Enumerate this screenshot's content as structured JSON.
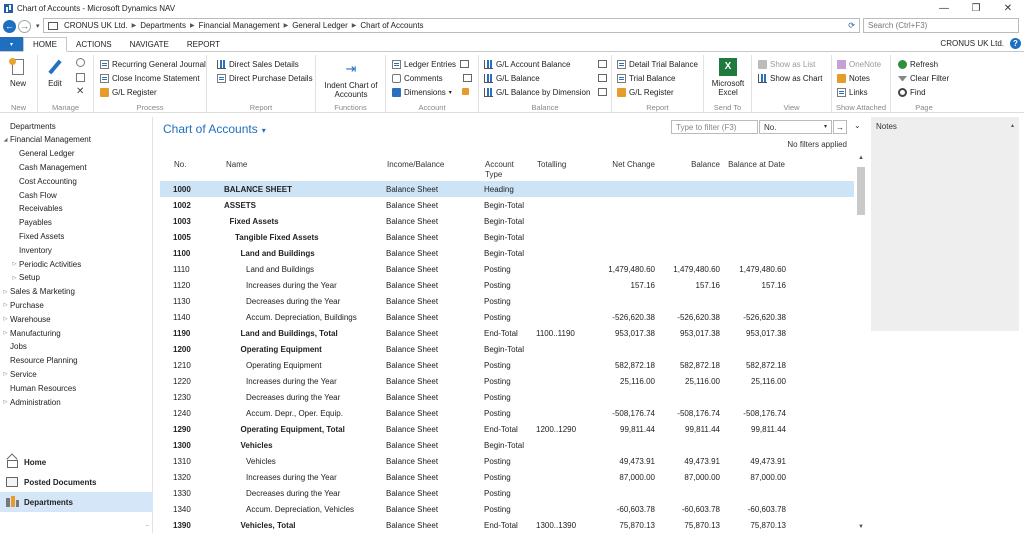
{
  "window": {
    "title": "Chart of Accounts - Microsoft Dynamics NAV",
    "controls": [
      "—",
      "❐",
      "✕"
    ]
  },
  "address": {
    "crumbs": [
      "CRONUS UK Ltd.",
      "Departments",
      "Financial Management",
      "General Ledger",
      "Chart of Accounts"
    ],
    "search_placeholder": "Search (Ctrl+F3)"
  },
  "ribbon_tabs": {
    "file": "▾",
    "items": [
      "HOME",
      "ACTIONS",
      "NAVIGATE",
      "REPORT"
    ],
    "company": "CRONUS UK Ltd.",
    "help": "?"
  },
  "ribbon": {
    "new": {
      "label": "New",
      "group": "New"
    },
    "manage": {
      "edit": "Edit",
      "group": "Manage"
    },
    "process": {
      "items": [
        "Recurring General Journal",
        "Close Income Statement",
        "G/L Register"
      ],
      "group": "Process"
    },
    "report": {
      "items": [
        "Direct Sales Details",
        "Direct Purchase Details"
      ],
      "group": "Report"
    },
    "functions": {
      "label": "Indent Chart of Accounts",
      "group": "Functions"
    },
    "account": {
      "items": [
        "Ledger Entries",
        "Comments",
        "Dimensions"
      ],
      "group": "Account"
    },
    "balance": {
      "items": [
        "G/L Account Balance",
        "G/L Balance",
        "G/L Balance by Dimension"
      ],
      "group": "Balance"
    },
    "report2": {
      "items": [
        "Detail Trial Balance",
        "Trial Balance",
        "G/L Register"
      ],
      "group": "Report"
    },
    "sendto": {
      "label": "Microsoft Excel",
      "group": "Send To"
    },
    "view": {
      "items": [
        "Show as List",
        "Show as Chart"
      ],
      "group": "View"
    },
    "attached": {
      "items": [
        "OneNote",
        "Notes",
        "Links"
      ],
      "group": "Show Attached"
    },
    "page": {
      "items": [
        "Refresh",
        "Clear Filter",
        "Find"
      ],
      "group": "Page"
    }
  },
  "sidebar": {
    "items": [
      {
        "label": "Departments",
        "level": 0,
        "arrow": ""
      },
      {
        "label": "Financial Management",
        "level": 0,
        "arrow": "◢"
      },
      {
        "label": "General Ledger",
        "level": 1,
        "arrow": ""
      },
      {
        "label": "Cash Management",
        "level": 1,
        "arrow": ""
      },
      {
        "label": "Cost Accounting",
        "level": 1,
        "arrow": ""
      },
      {
        "label": "Cash Flow",
        "level": 1,
        "arrow": ""
      },
      {
        "label": "Receivables",
        "level": 1,
        "arrow": ""
      },
      {
        "label": "Payables",
        "level": 1,
        "arrow": ""
      },
      {
        "label": "Fixed Assets",
        "level": 1,
        "arrow": ""
      },
      {
        "label": "Inventory",
        "level": 1,
        "arrow": ""
      },
      {
        "label": "Periodic Activities",
        "level": 1,
        "arrow": "▷"
      },
      {
        "label": "Setup",
        "level": 1,
        "arrow": "▷"
      },
      {
        "label": "Sales & Marketing",
        "level": 0,
        "arrow": "▷"
      },
      {
        "label": "Purchase",
        "level": 0,
        "arrow": "▷"
      },
      {
        "label": "Warehouse",
        "level": 0,
        "arrow": "▷"
      },
      {
        "label": "Manufacturing",
        "level": 0,
        "arrow": "▷"
      },
      {
        "label": "Jobs",
        "level": 0,
        "arrow": ""
      },
      {
        "label": "Resource Planning",
        "level": 0,
        "arrow": ""
      },
      {
        "label": "Service",
        "level": 0,
        "arrow": "▷"
      },
      {
        "label": "Human Resources",
        "level": 0,
        "arrow": ""
      },
      {
        "label": "Administration",
        "level": 0,
        "arrow": "▷"
      }
    ],
    "bottom": [
      "Home",
      "Posted Documents",
      "Departments"
    ]
  },
  "page": {
    "title": "Chart of Accounts",
    "dropdown": "▾",
    "filter_placeholder": "Type to filter (F3)",
    "filter_field": "No.",
    "go": "→",
    "no_filters": "No filters applied"
  },
  "columns": {
    "no": "No.",
    "name": "Name",
    "income": "Income/Balance",
    "type_l1": "Account",
    "type_l2": "Type",
    "totalling": "Totalling",
    "net": "Net Change",
    "balance": "Balance",
    "bad": "Balance at Date"
  },
  "rows": [
    {
      "no": "1000",
      "name": "BALANCE SHEET",
      "indent": 0,
      "bold": true,
      "ib": "Balance Sheet",
      "type": "Heading",
      "tot": "",
      "net": "",
      "bal": "",
      "bad": ""
    },
    {
      "no": "1002",
      "name": "ASSETS",
      "indent": 0,
      "bold": true,
      "ib": "Balance Sheet",
      "type": "Begin-Total",
      "tot": "",
      "net": "",
      "bal": "",
      "bad": ""
    },
    {
      "no": "1003",
      "name": "Fixed Assets",
      "indent": 1,
      "bold": true,
      "ib": "Balance Sheet",
      "type": "Begin-Total",
      "tot": "",
      "net": "",
      "bal": "",
      "bad": ""
    },
    {
      "no": "1005",
      "name": "Tangible Fixed Assets",
      "indent": 2,
      "bold": true,
      "ib": "Balance Sheet",
      "type": "Begin-Total",
      "tot": "",
      "net": "",
      "bal": "",
      "bad": ""
    },
    {
      "no": "1100",
      "name": "Land and Buildings",
      "indent": 3,
      "bold": true,
      "ib": "Balance Sheet",
      "type": "Begin-Total",
      "tot": "",
      "net": "",
      "bal": "",
      "bad": ""
    },
    {
      "no": "1110",
      "name": "Land and Buildings",
      "indent": 4,
      "bold": false,
      "ib": "Balance Sheet",
      "type": "Posting",
      "tot": "",
      "net": "1,479,480.60",
      "bal": "1,479,480.60",
      "bad": "1,479,480.60"
    },
    {
      "no": "1120",
      "name": "Increases during the Year",
      "indent": 4,
      "bold": false,
      "ib": "Balance Sheet",
      "type": "Posting",
      "tot": "",
      "net": "157.16",
      "bal": "157.16",
      "bad": "157.16"
    },
    {
      "no": "1130",
      "name": "Decreases during the Year",
      "indent": 4,
      "bold": false,
      "ib": "Balance Sheet",
      "type": "Posting",
      "tot": "",
      "net": "",
      "bal": "",
      "bad": ""
    },
    {
      "no": "1140",
      "name": "Accum. Depreciation, Buildings",
      "indent": 4,
      "bold": false,
      "ib": "Balance Sheet",
      "type": "Posting",
      "tot": "",
      "net": "-526,620.38",
      "bal": "-526,620.38",
      "bad": "-526,620.38"
    },
    {
      "no": "1190",
      "name": "Land and Buildings, Total",
      "indent": 3,
      "bold": true,
      "ib": "Balance Sheet",
      "type": "End-Total",
      "tot": "1100..1190",
      "net": "953,017.38",
      "bal": "953,017.38",
      "bad": "953,017.38"
    },
    {
      "no": "1200",
      "name": "Operating Equipment",
      "indent": 3,
      "bold": true,
      "ib": "Balance Sheet",
      "type": "Begin-Total",
      "tot": "",
      "net": "",
      "bal": "",
      "bad": ""
    },
    {
      "no": "1210",
      "name": "Operating Equipment",
      "indent": 4,
      "bold": false,
      "ib": "Balance Sheet",
      "type": "Posting",
      "tot": "",
      "net": "582,872.18",
      "bal": "582,872.18",
      "bad": "582,872.18"
    },
    {
      "no": "1220",
      "name": "Increases during the Year",
      "indent": 4,
      "bold": false,
      "ib": "Balance Sheet",
      "type": "Posting",
      "tot": "",
      "net": "25,116.00",
      "bal": "25,116.00",
      "bad": "25,116.00"
    },
    {
      "no": "1230",
      "name": "Decreases during the Year",
      "indent": 4,
      "bold": false,
      "ib": "Balance Sheet",
      "type": "Posting",
      "tot": "",
      "net": "",
      "bal": "",
      "bad": ""
    },
    {
      "no": "1240",
      "name": "Accum. Depr., Oper. Equip.",
      "indent": 4,
      "bold": false,
      "ib": "Balance Sheet",
      "type": "Posting",
      "tot": "",
      "net": "-508,176.74",
      "bal": "-508,176.74",
      "bad": "-508,176.74"
    },
    {
      "no": "1290",
      "name": "Operating Equipment, Total",
      "indent": 3,
      "bold": true,
      "ib": "Balance Sheet",
      "type": "End-Total",
      "tot": "1200..1290",
      "net": "99,811.44",
      "bal": "99,811.44",
      "bad": "99,811.44"
    },
    {
      "no": "1300",
      "name": "Vehicles",
      "indent": 3,
      "bold": true,
      "ib": "Balance Sheet",
      "type": "Begin-Total",
      "tot": "",
      "net": "",
      "bal": "",
      "bad": ""
    },
    {
      "no": "1310",
      "name": "Vehicles",
      "indent": 4,
      "bold": false,
      "ib": "Balance Sheet",
      "type": "Posting",
      "tot": "",
      "net": "49,473.91",
      "bal": "49,473.91",
      "bad": "49,473.91"
    },
    {
      "no": "1320",
      "name": "Increases during the Year",
      "indent": 4,
      "bold": false,
      "ib": "Balance Sheet",
      "type": "Posting",
      "tot": "",
      "net": "87,000.00",
      "bal": "87,000.00",
      "bad": "87,000.00"
    },
    {
      "no": "1330",
      "name": "Decreases during the Year",
      "indent": 4,
      "bold": false,
      "ib": "Balance Sheet",
      "type": "Posting",
      "tot": "",
      "net": "",
      "bal": "",
      "bad": ""
    },
    {
      "no": "1340",
      "name": "Accum. Depreciation, Vehicles",
      "indent": 4,
      "bold": false,
      "ib": "Balance Sheet",
      "type": "Posting",
      "tot": "",
      "net": "-60,603.78",
      "bal": "-60,603.78",
      "bad": "-60,603.78"
    },
    {
      "no": "1390",
      "name": "Vehicles, Total",
      "indent": 3,
      "bold": true,
      "ib": "Balance Sheet",
      "type": "End-Total",
      "tot": "1300..1390",
      "net": "75,870.13",
      "bal": "75,870.13",
      "bad": "75,870.13"
    }
  ],
  "notes": {
    "title": "Notes",
    "collapse": "▴"
  }
}
